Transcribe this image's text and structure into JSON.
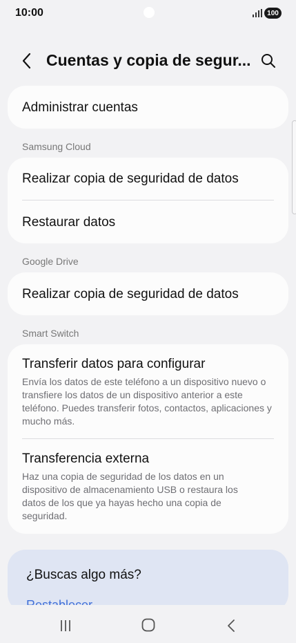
{
  "status_bar": {
    "time": "10:00",
    "battery": "100"
  },
  "header": {
    "title": "Cuentas y copia de segur..."
  },
  "sections": {
    "accounts": {
      "manage_accounts": "Administrar cuentas"
    },
    "samsung_cloud": {
      "label": "Samsung Cloud",
      "backup": "Realizar copia de seguridad de datos",
      "restore": "Restaurar datos"
    },
    "google_drive": {
      "label": "Google Drive",
      "backup": "Realizar copia de seguridad de datos"
    },
    "smart_switch": {
      "label": "Smart Switch",
      "transfer_title": "Transferir datos para configurar",
      "transfer_desc": "Envía los datos de este teléfono a un dispositivo nuevo o transfiere los datos de un dispositivo anterior a este teléfono. Puedes transferir fotos, contactos, aplicaciones y mucho más.",
      "external_title": "Transferencia externa",
      "external_desc": "Haz una copia de seguridad de los datos en un dispositivo de almacenamiento USB o restaura los datos de los que ya hayas hecho una copia de seguridad."
    }
  },
  "help_card": {
    "title": "¿Buscas algo más?",
    "link": "Restablecer"
  },
  "colors": {
    "background": "#f2f2f4",
    "card": "#fcfcfc",
    "help_card": "#dfe5f3",
    "link": "#3f6fd8"
  }
}
